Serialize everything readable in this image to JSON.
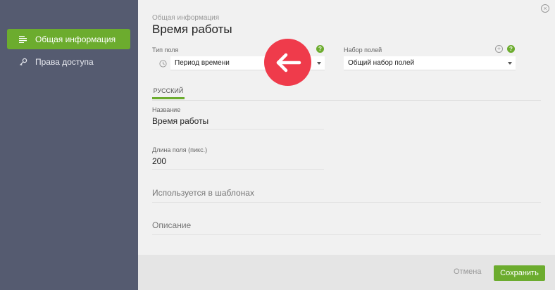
{
  "sidebar": {
    "items": [
      {
        "label": "Общая информация",
        "icon": "list-lines-icon",
        "active": true
      },
      {
        "label": "Права доступа",
        "icon": "key-icon",
        "active": false
      }
    ]
  },
  "header": {
    "breadcrumb": "Общая информация",
    "title": "Время работы"
  },
  "field_type": {
    "label": "Тип поля",
    "value": "Период времени",
    "help": "?"
  },
  "field_set": {
    "label": "Набор полей",
    "value": "Общий набор полей",
    "help": "?",
    "add": "+"
  },
  "tabs": [
    {
      "label": "РУССКИЙ",
      "active": true
    }
  ],
  "form": {
    "name_label": "Название",
    "name_value": "Время работы",
    "length_label": "Длина поля (пикс.)",
    "length_value": "200",
    "templates_placeholder": "Используется в шаблонах",
    "description_placeholder": "Описание"
  },
  "footer": {
    "cancel_label": "Отмена",
    "save_label": "Сохранить"
  },
  "colors": {
    "accent": "#6cac2e",
    "sidebar_bg": "#555b70",
    "annotation_red": "#ef3b4b"
  }
}
